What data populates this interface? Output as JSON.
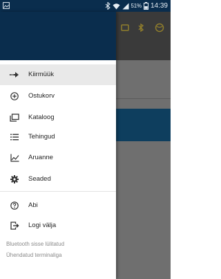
{
  "status_bar": {
    "battery_percent": "51%",
    "time": "14:39"
  },
  "menu": {
    "items": [
      {
        "label": "Kiirmüük",
        "icon": "fast-forward-arrow-icon",
        "active": true
      },
      {
        "label": "Ostukorv",
        "icon": "add-circle-icon"
      },
      {
        "label": "Kataloog",
        "icon": "catalog-icon"
      },
      {
        "label": "Tehingud",
        "icon": "list-icon"
      },
      {
        "label": "Aruanne",
        "icon": "chart-line-icon"
      },
      {
        "label": "Seaded",
        "icon": "gear-icon"
      },
      {
        "label": "Abi",
        "icon": "help-circle-icon"
      },
      {
        "label": "Logi välja",
        "icon": "logout-icon"
      }
    ]
  },
  "footer": {
    "bluetooth_status": "Bluetooth sisse lülitatud",
    "terminal_status": "Ühendatud terminaliga"
  },
  "colors": {
    "header": "#0a2d4d",
    "active_item": "#e9e9e9",
    "scrim": "#6f6f6f",
    "background_accent": "#0e3e5e"
  }
}
